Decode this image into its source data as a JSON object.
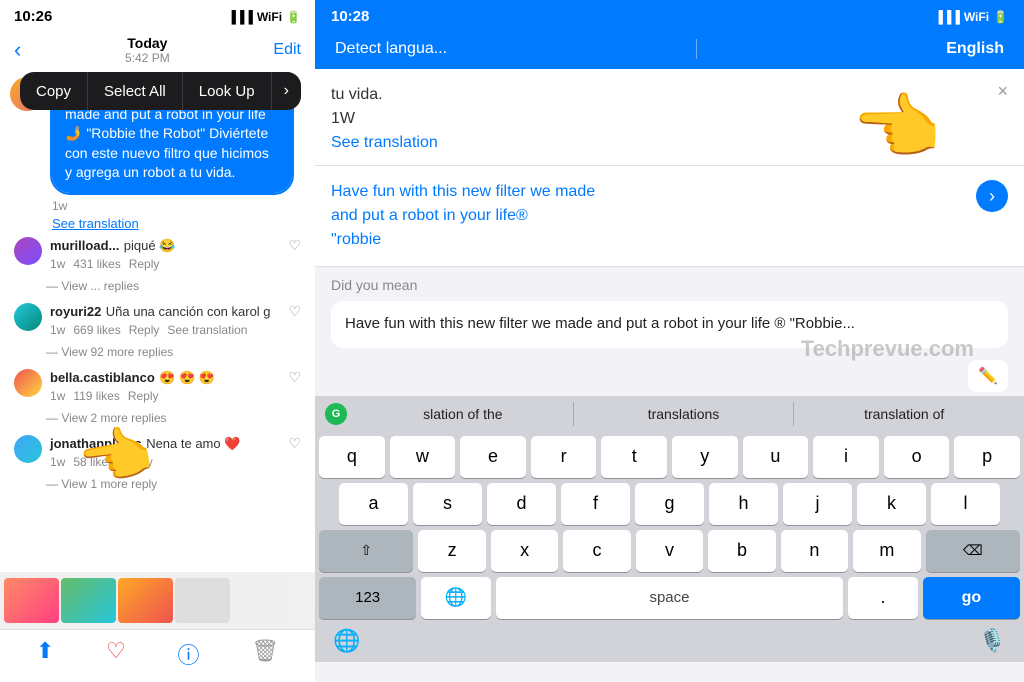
{
  "left": {
    "status_time": "10:26",
    "nav_date": "Today",
    "nav_time": "5:42 PM",
    "nav_edit": "Edit",
    "context_copy": "Copy",
    "context_select_all": "Select All",
    "context_look_up": "Look Up",
    "main_bubble": "Have fun with this new filter we made and put a robot in your life 🤳 \"Robbie the Robot\"  Diviértete con este nuevo filtro que hicimos y agrega un robot a tu vida.",
    "bubble_meta": "1w",
    "see_translation": "See translation",
    "comments": [
      {
        "username": "murilload...",
        "text": "piqué 😂",
        "age": "1w",
        "likes": "431",
        "view_replies": "View ... replies"
      },
      {
        "username": "royuri22",
        "text": "Uña una canción con karol g",
        "age": "1w",
        "likes": "669",
        "see_translation": "See translation",
        "view_replies": "View 92 more replies"
      },
      {
        "username": "bella.castiblanco",
        "text": "😍 😍 😍",
        "age": "1w",
        "likes": "119",
        "view_replies": "View 2 more replies"
      },
      {
        "username": "jonathanplains",
        "text": "Nena te amo ❤️",
        "age": "1w",
        "likes": "58",
        "view_replies": "View 1 more reply"
      }
    ]
  },
  "right": {
    "status_time": "10:28",
    "detect_lang": "Detect langua...",
    "target_lang": "English",
    "input_text": "tu vida.\n1W\nSee translation",
    "close_btn": "×",
    "translation_text": "Have fun with this new filter we made\nand put a robot in your life®\n\"robbie",
    "did_you_mean_label": "Did you mean",
    "did_you_mean_text": "Have fun with this new filter we made and put a robot in your life ® \"Robbie...",
    "keyboard": {
      "suggestions": [
        "slation of the",
        "translations",
        "translation of"
      ],
      "rows": [
        [
          "q",
          "w",
          "e",
          "r",
          "t",
          "y",
          "u",
          "i",
          "o",
          "p"
        ],
        [
          "a",
          "s",
          "d",
          "f",
          "g",
          "h",
          "j",
          "k",
          "l"
        ],
        [
          "z",
          "x",
          "c",
          "v",
          "b",
          "n",
          "m"
        ],
        [
          "123",
          "space",
          "go"
        ]
      ],
      "space_label": "space",
      "go_label": "go",
      "num_label": "123"
    },
    "watermark": "Techprevue.com"
  }
}
